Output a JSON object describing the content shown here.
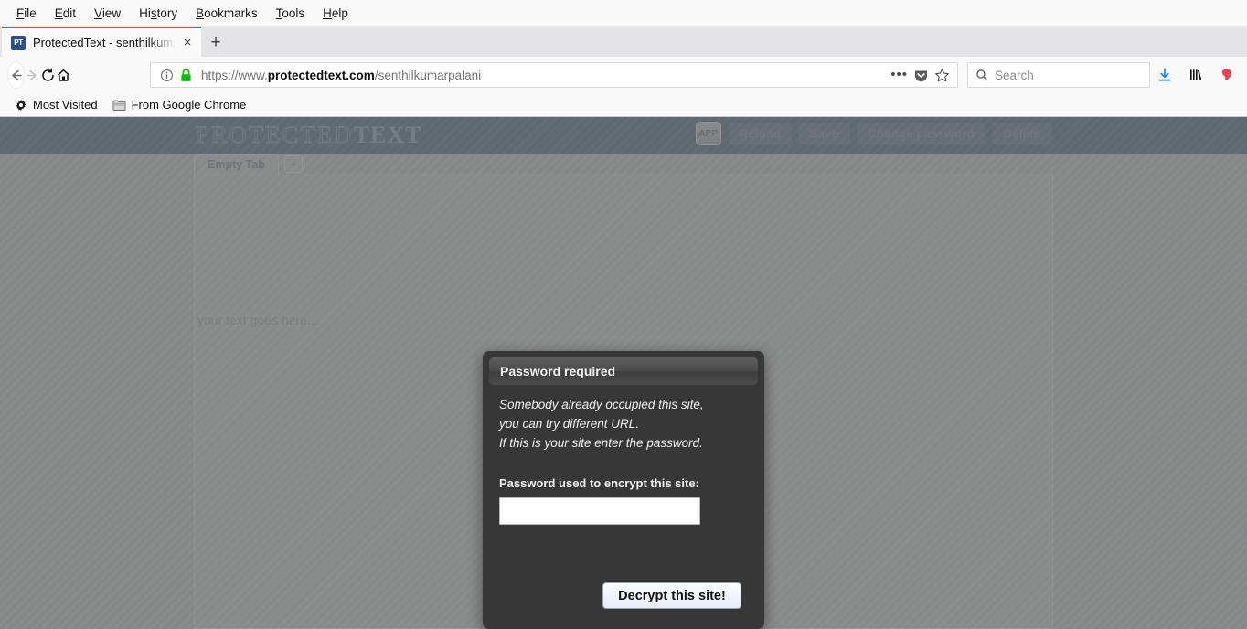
{
  "browser": {
    "menubar": [
      {
        "label": "File",
        "accesskey": "F"
      },
      {
        "label": "Edit",
        "accesskey": "E"
      },
      {
        "label": "View",
        "accesskey": "V"
      },
      {
        "label": "History",
        "accesskey": "s"
      },
      {
        "label": "Bookmarks",
        "accesskey": "B"
      },
      {
        "label": "Tools",
        "accesskey": "T"
      },
      {
        "label": "Help",
        "accesskey": "H"
      }
    ],
    "tab": {
      "favicon_text": "PT",
      "title": "ProtectedText - senthilkum",
      "close_label": "×",
      "newtab_label": "+"
    },
    "urlbar": {
      "scheme": "https://www.",
      "domain": "protectedtext.com",
      "path": "/senthilkumarpalani",
      "info_icon": "info-icon",
      "lock_icon": "lock-icon",
      "lock_color": "#12bc00",
      "more_icon": "•••",
      "pocket_icon": "pocket-icon",
      "bookmark_icon": "star-icon"
    },
    "search": {
      "placeholder": "Search",
      "icon": "search-icon"
    },
    "toolbar_right": [
      {
        "name": "downloads-icon",
        "color": "#0a84ff"
      },
      {
        "name": "library-icon",
        "color": "#0c0c0d"
      },
      {
        "name": "pocket-save-icon",
        "color": "#ee4056"
      },
      {
        "name": "overflow-chevrons-icon",
        "color": "#0c0c0d"
      },
      {
        "name": "hamburger-menu-icon",
        "color": "#0c0c0d"
      }
    ],
    "bookmarks": [
      {
        "label": "Most Visited",
        "icon": "gear-icon"
      },
      {
        "label": "From Google Chrome",
        "icon": "folder-icon"
      }
    ]
  },
  "site": {
    "logo": {
      "part1": "PROTECTED",
      "part2": "TEXT"
    },
    "header_buttons": [
      {
        "label": "APP",
        "name": "app-button",
        "disabled": false
      },
      {
        "label": "Reload",
        "name": "reload-button",
        "disabled": true
      },
      {
        "label": "Save",
        "name": "save-button",
        "disabled": true
      },
      {
        "label": "Change password",
        "name": "change-password-button",
        "disabled": true
      },
      {
        "label": "Delete",
        "name": "delete-button",
        "disabled": true
      }
    ],
    "doc_tab": "Empty Tab",
    "add_tab_label": "+",
    "editor_placeholder": "your text goes here...",
    "colors": {
      "header_band": "#4a5a66",
      "page_bg": "#8e9091",
      "logo_text": "#6d7d89"
    }
  },
  "modal": {
    "title": "Password required",
    "message_line1": "Somebody already occupied this site,",
    "message_line2": "you can try different URL.",
    "message_line3": "If this is your site enter the password.",
    "field_label": "Password used to encrypt this site:",
    "password_value": "",
    "password_placeholder": "",
    "submit_label": "Decrypt this site!",
    "colors": {
      "dialog_bg": "#373737",
      "titlebar_bg": "#4b4b4b",
      "button_bg": "#eef1f8"
    }
  }
}
